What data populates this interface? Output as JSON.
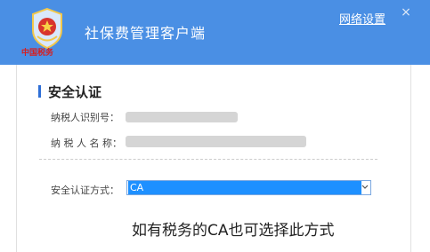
{
  "window": {
    "app_title": "社保费管理客户端",
    "network_settings": "网络设置",
    "close_symbol": "×",
    "logo_subtext": "中国税务"
  },
  "section": {
    "title": "安全认证"
  },
  "fields": {
    "taxpayer_id_label": "纳税人识别号：",
    "taxpayer_name_label": "纳 税 人 名 称：",
    "auth_method_label": "安全认证方式：",
    "auth_method_value": "CA"
  },
  "annotation": {
    "note": "如有税务的CA也可选择此方式"
  },
  "colors": {
    "titlebar": "#4a8fe4",
    "accent": "#2f6fd6",
    "selected": "#1e90ff"
  },
  "icons": {
    "logo": "tax-emblem-icon",
    "close": "close-icon",
    "dropdown": "chevron-down-icon"
  }
}
